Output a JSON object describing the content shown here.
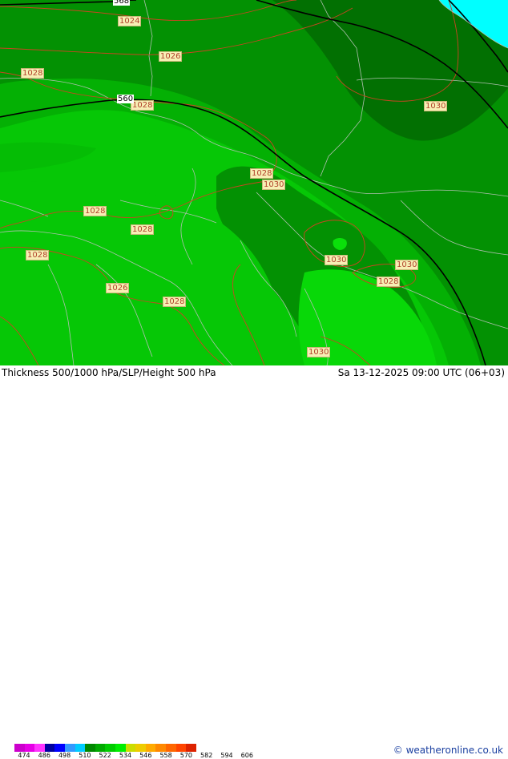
{
  "map": {
    "pressure_labels": [
      "1024",
      "1026",
      "1028",
      "1028",
      "1030",
      "1028",
      "1030",
      "1028",
      "1028",
      "1028",
      "1030",
      "1030",
      "1028",
      "1026",
      "1028",
      "1030"
    ],
    "height_labels": [
      "560",
      "568"
    ],
    "colors": {
      "thickness_546": "#06c706",
      "thickness_552": "#04b004",
      "thickness_558": "#039103",
      "thickness_564": "#027002",
      "thickness_570": "#0ae00a",
      "sea": "#00ffff",
      "isobar": "#cc4422",
      "border": "#b0c0b0",
      "height_contour": "#000000",
      "label_bg": "#f7efb5",
      "label_text": "#b0402a"
    }
  },
  "footer": {
    "title": "Thickness 500/1000 hPa/SLP/Height 500 hPa",
    "datetime": "Sa 13-12-2025 09:00 UTC (06+03)",
    "copyright": "© weatheronline.co.uk",
    "legend_ticks": [
      "474",
      "486",
      "498",
      "510",
      "522",
      "534",
      "546",
      "558",
      "570",
      "582",
      "594",
      "606"
    ],
    "legend_colors": [
      "#cc00cc",
      "#e600e6",
      "#ff33ff",
      "#0000a0",
      "#0000ff",
      "#3399ff",
      "#00ccff",
      "#008800",
      "#00aa00",
      "#00cc00",
      "#00ee00",
      "#ccdd00",
      "#eecc00",
      "#ffaa00",
      "#ff8800",
      "#ff6600",
      "#ff4400",
      "#dd2200"
    ]
  }
}
